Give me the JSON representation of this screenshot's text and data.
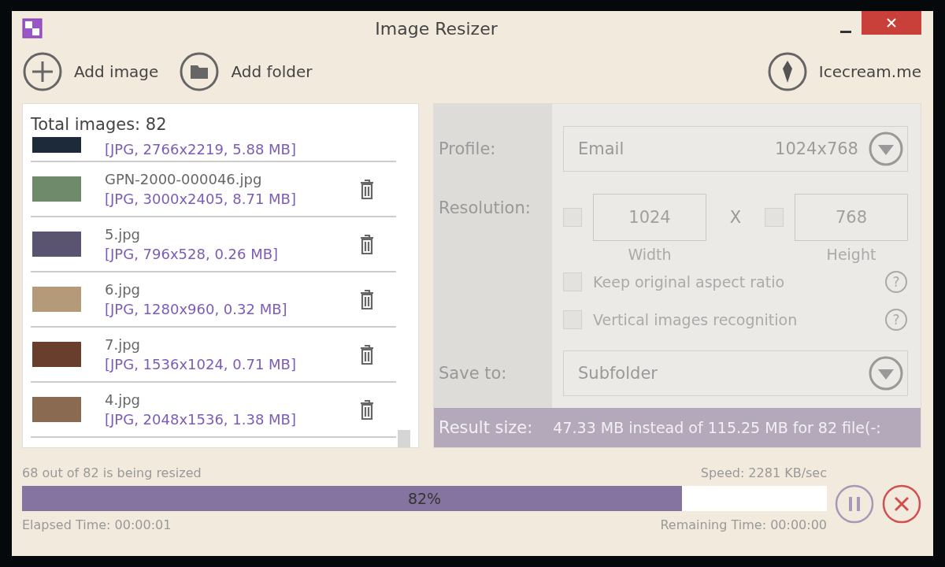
{
  "window": {
    "title": "Image Resizer"
  },
  "toolbar": [
    {
      "kind": "add",
      "label": "Add image"
    },
    {
      "kind": "folder",
      "label": "Add folder"
    }
  ],
  "brand": {
    "label": "Icecream.me"
  },
  "file_list": {
    "title": "Total images: 82",
    "items": [
      {
        "meta": "[JPG, 2766x2219, 5.88 MB]"
      },
      {
        "name": "GPN-2000-000046.jpg",
        "meta": "[JPG, 3000x2405, 8.71 MB]"
      },
      {
        "name": "5.jpg",
        "meta": "[JPG, 796x528, 0.26 MB]"
      },
      {
        "name": "6.jpg",
        "meta": "[JPG, 1280x960, 0.32 MB]"
      },
      {
        "name": "7.jpg",
        "meta": "[JPG, 1536x1024, 0.71 MB]"
      },
      {
        "name": "4.jpg",
        "meta": "[JPG, 2048x1536, 1.38 MB]"
      }
    ]
  },
  "settings": {
    "disabled": true,
    "profile": {
      "label": "Profile:",
      "value": "Email",
      "size": "1024x768"
    },
    "resolution": {
      "label": "Resolution:",
      "width": {
        "checked": false,
        "value": "1024",
        "caption": "Width"
      },
      "separator": "X",
      "height": {
        "checked": false,
        "value": "768",
        "caption": "Height"
      }
    },
    "options": [
      {
        "label": "Keep original aspect ratio",
        "checked": false,
        "help": "?"
      },
      {
        "label": "Vertical images recognition",
        "checked": false,
        "help": "?"
      }
    ],
    "save_to": {
      "label": "Save to:",
      "value": "Subfolder"
    },
    "result": {
      "label": "Result size:",
      "value": "47.33 MB instead of 115.25 MB for 82 file(-:"
    }
  },
  "progress": {
    "status": "68 out of 82 is being resized",
    "speed": "Speed: 2281 KB/sec",
    "level": 0.82,
    "reading": "82%",
    "elapsed": "Elapsed Time: 00:00:01",
    "remaining": "Remaining Time: 00:00:00"
  }
}
